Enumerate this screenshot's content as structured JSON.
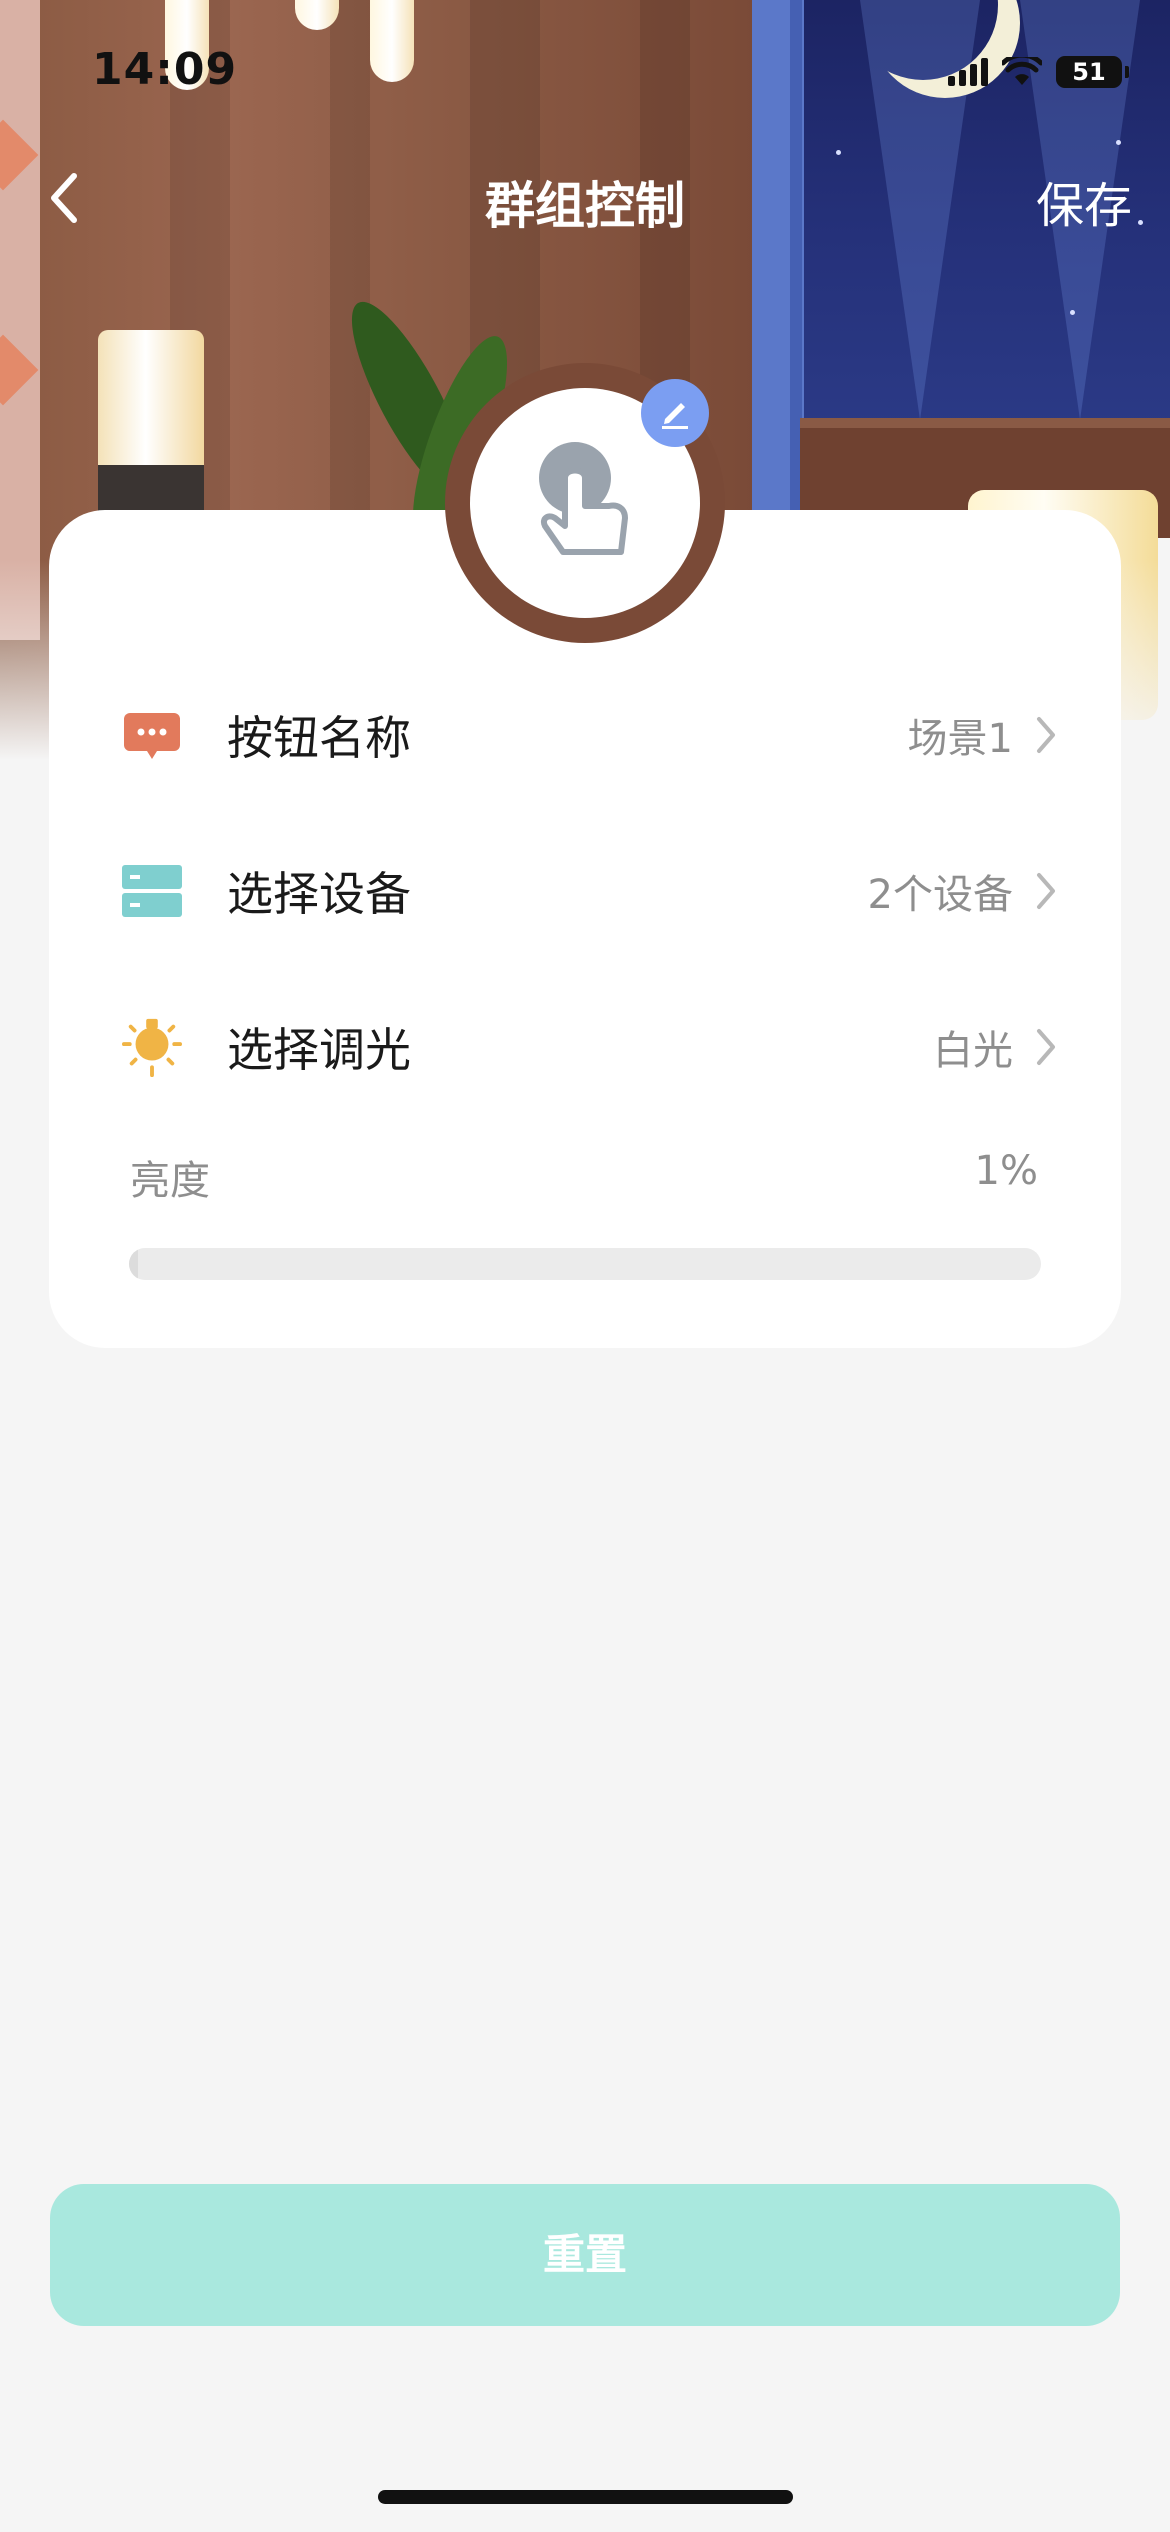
{
  "status_bar": {
    "time": "14:09",
    "battery": "51"
  },
  "nav": {
    "title": "群组控制",
    "save_label": "保存"
  },
  "settings": {
    "rows": [
      {
        "label": "按钮名称",
        "value": "场景1",
        "icon": "chat-bubble-icon",
        "icon_color": "#e27a5c"
      },
      {
        "label": "选择设备",
        "value": "2个设备",
        "icon": "device-list-icon",
        "icon_color": "#7fcfcf"
      },
      {
        "label": "选择调光",
        "value": "白光",
        "icon": "bulb-icon",
        "icon_color": "#f0b445"
      }
    ],
    "brightness": {
      "label": "亮度",
      "value": "1%",
      "level": 0.01
    }
  },
  "actions": {
    "reset_label": "重置"
  },
  "colors": {
    "accent_badge": "#7b9ef2",
    "reset_button": "#a9e8de",
    "background": "#f5f5f5"
  }
}
